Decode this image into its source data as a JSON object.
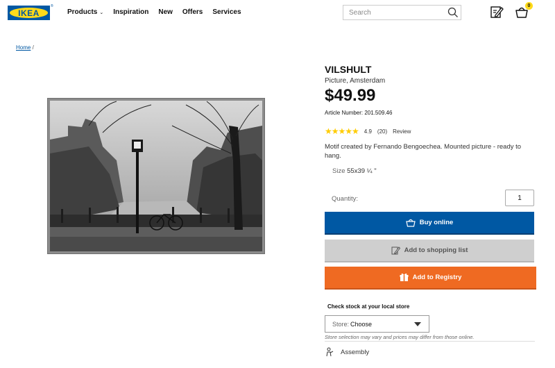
{
  "header": {
    "logo_text": "IKEA",
    "nav": [
      {
        "label": "Products",
        "has_dropdown": true
      },
      {
        "label": "Inspiration"
      },
      {
        "label": "New"
      },
      {
        "label": "Offers"
      },
      {
        "label": "Services"
      }
    ],
    "search_placeholder": "Search",
    "basket_count": "0",
    "icons": [
      "search-icon",
      "shopping-list-icon",
      "basket-icon"
    ]
  },
  "breadcrumb": {
    "home": "Home",
    "separator": "/"
  },
  "product": {
    "name": "VILSHULT",
    "type": "Picture, Amsterdam",
    "price": "$49.99",
    "article_number": "Article Number: 201.509.46",
    "rating": {
      "stars": 5,
      "score": "4.9",
      "count": "(20)",
      "review_label": "Review"
    },
    "description": "Motif created by Fernando Bengoechea. Mounted picture - ready to hang.",
    "size_label": "Size",
    "size_value": "55x39 ¼ \"",
    "quantity_label": "Quantity:",
    "quantity_value": "1"
  },
  "actions": {
    "buy_online": "Buy online",
    "add_to_list": "Add to shopping list",
    "add_to_registry": "Add to Registry"
  },
  "stock": {
    "title": "Check stock at your local store",
    "store_label": "Store:",
    "store_value": "Choose",
    "note": "Store selection may vary and prices may differ from those online."
  },
  "assembly": {
    "label": "Assembly"
  },
  "colors": {
    "ikea_blue": "#0058a3",
    "ikea_yellow": "#ffda1a",
    "registry_orange": "#ef6a22",
    "list_gray": "#cfcfcf",
    "star_yellow": "#ffcc00"
  }
}
